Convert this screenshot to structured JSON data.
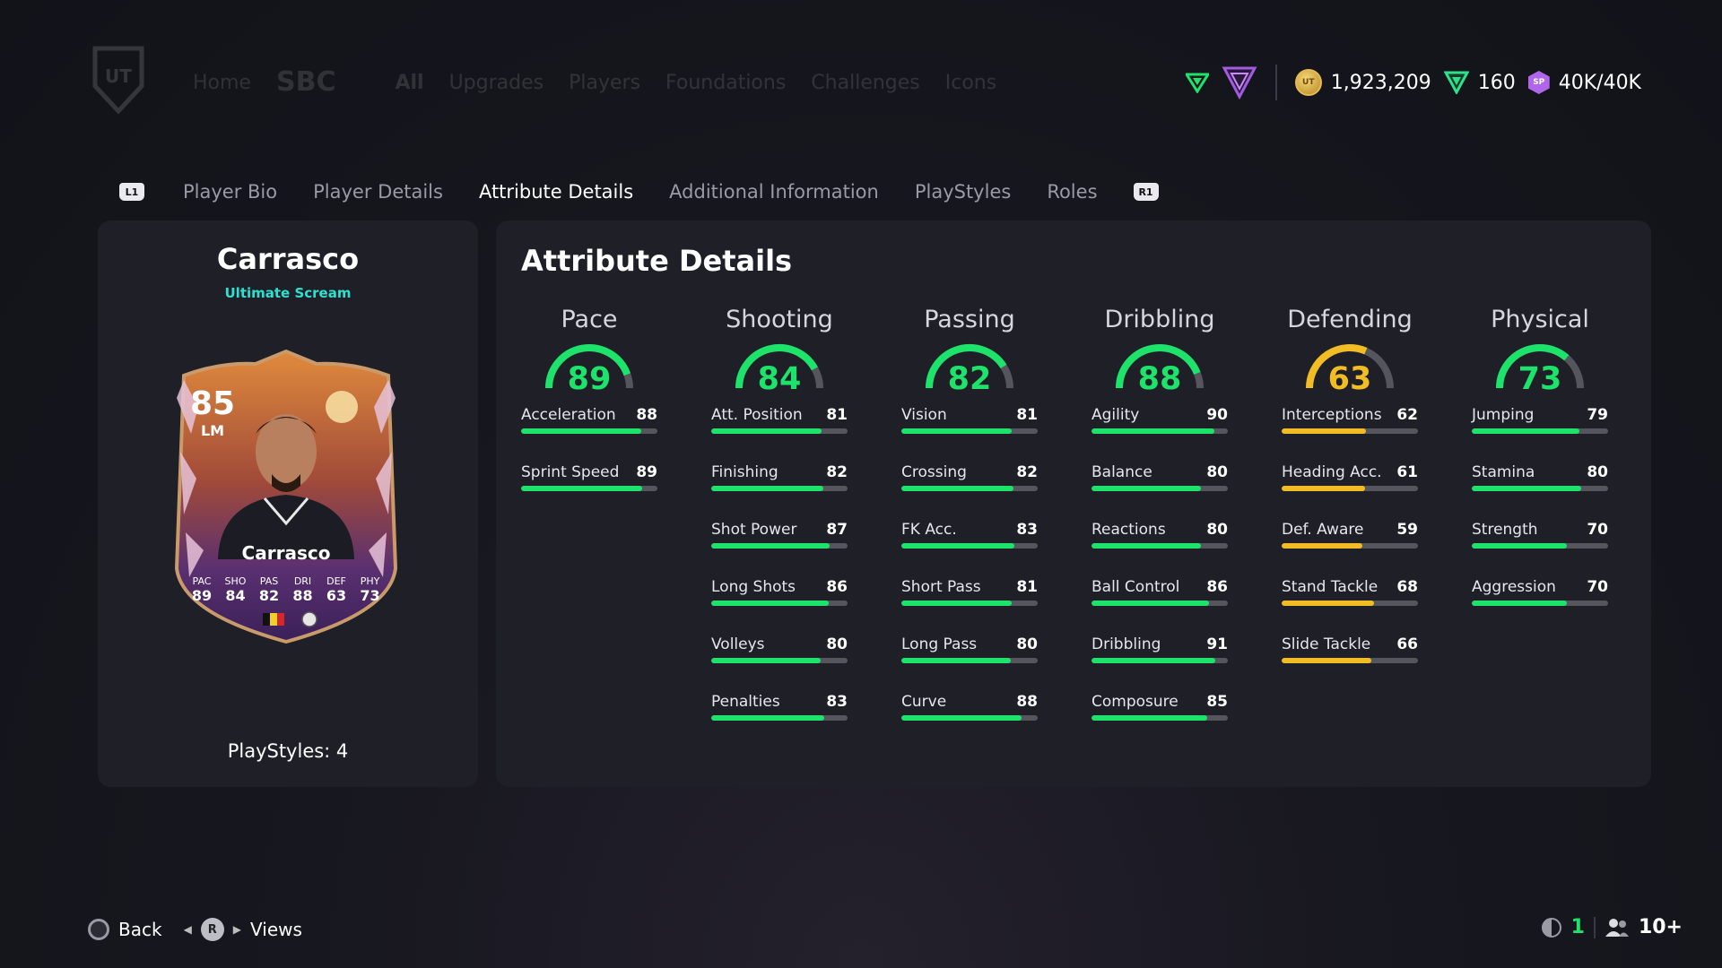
{
  "ghost_nav": {
    "home": "Home",
    "sbc": "SBC",
    "all": "All",
    "others": [
      "Upgrades",
      "Players",
      "Foundations",
      "Challenges",
      "Icons"
    ]
  },
  "currency": {
    "coins": "1,923,209",
    "points": "160",
    "sp": "40K/40K",
    "coin_icon_text": "UT",
    "sp_icon_text": "SP"
  },
  "tabs": {
    "left_shoulder": "L1",
    "right_shoulder": "R1",
    "items": [
      "Player Bio",
      "Player Details",
      "Attribute Details",
      "Additional Information",
      "PlayStyles",
      "Roles"
    ],
    "active": "Attribute Details"
  },
  "player": {
    "name": "Carrasco",
    "card_type": "Ultimate Scream",
    "rating": "85",
    "position": "LM",
    "card_name": "Carrasco",
    "card_stats": [
      {
        "label": "PAC",
        "value": "89"
      },
      {
        "label": "SHO",
        "value": "84"
      },
      {
        "label": "PAS",
        "value": "82"
      },
      {
        "label": "DRI",
        "value": "88"
      },
      {
        "label": "DEF",
        "value": "63"
      },
      {
        "label": "PHY",
        "value": "73"
      }
    ],
    "playstyles": "PlayStyles: 4"
  },
  "attributes": {
    "title": "Attribute Details",
    "colors": {
      "green": "#1ee36a",
      "yellow": "#f2bd24",
      "track": "#55555e"
    },
    "categories": [
      {
        "name": "Pace",
        "value": 89,
        "color": "green",
        "attrs": [
          {
            "name": "Acceleration",
            "value": 88
          },
          {
            "name": "Sprint Speed",
            "value": 89
          }
        ]
      },
      {
        "name": "Shooting",
        "value": 84,
        "color": "green",
        "attrs": [
          {
            "name": "Att. Position",
            "value": 81
          },
          {
            "name": "Finishing",
            "value": 82
          },
          {
            "name": "Shot Power",
            "value": 87
          },
          {
            "name": "Long Shots",
            "value": 86
          },
          {
            "name": "Volleys",
            "value": 80
          },
          {
            "name": "Penalties",
            "value": 83
          }
        ]
      },
      {
        "name": "Passing",
        "value": 82,
        "color": "green",
        "attrs": [
          {
            "name": "Vision",
            "value": 81
          },
          {
            "name": "Crossing",
            "value": 82
          },
          {
            "name": "FK Acc.",
            "value": 83
          },
          {
            "name": "Short Pass",
            "value": 81
          },
          {
            "name": "Long Pass",
            "value": 80
          },
          {
            "name": "Curve",
            "value": 88
          }
        ]
      },
      {
        "name": "Dribbling",
        "value": 88,
        "color": "green",
        "attrs": [
          {
            "name": "Agility",
            "value": 90
          },
          {
            "name": "Balance",
            "value": 80
          },
          {
            "name": "Reactions",
            "value": 80
          },
          {
            "name": "Ball Control",
            "value": 86
          },
          {
            "name": "Dribbling",
            "value": 91
          },
          {
            "name": "Composure",
            "value": 85
          }
        ]
      },
      {
        "name": "Defending",
        "value": 63,
        "color": "yellow",
        "attrs": [
          {
            "name": "Interceptions",
            "value": 62
          },
          {
            "name": "Heading Acc.",
            "value": 61
          },
          {
            "name": "Def. Aware",
            "value": 59
          },
          {
            "name": "Stand Tackle",
            "value": 68
          },
          {
            "name": "Slide Tackle",
            "value": 66
          }
        ]
      },
      {
        "name": "Physical",
        "value": 73,
        "color": "green",
        "attrs": [
          {
            "name": "Jumping",
            "value": 79
          },
          {
            "name": "Stamina",
            "value": 80
          },
          {
            "name": "Strength",
            "value": 70
          },
          {
            "name": "Aggression",
            "value": 70
          }
        ]
      }
    ]
  },
  "footer": {
    "back_label": "Back",
    "views_label": "Views",
    "r_button": "R",
    "count": "1",
    "players": "10+"
  }
}
